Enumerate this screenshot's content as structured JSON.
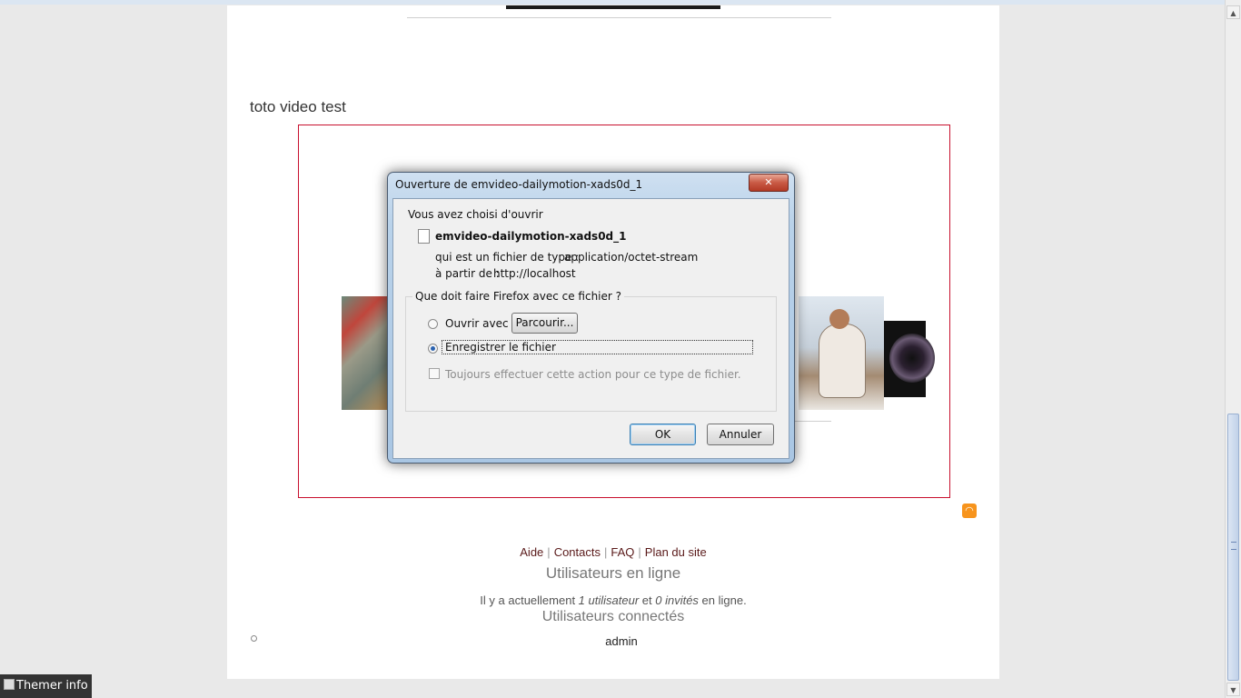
{
  "page": {
    "node_title": "toto video test",
    "rss_icon": "rss-icon"
  },
  "footer": {
    "links": [
      "Aide",
      "Contacts",
      "FAQ",
      "Plan du site"
    ],
    "online_title": "Utilisateurs en ligne",
    "online_text_pre": "Il y a actuellement ",
    "online_users": "1 utilisateur",
    "online_text_mid": " et ",
    "online_guests": "0 invités",
    "online_text_post": " en ligne.",
    "connected_title": "Utilisateurs connectés",
    "user": "admin"
  },
  "themer": {
    "label": "Themer info"
  },
  "dialog": {
    "title": "Ouverture de emvideo-dailymotion-xads0d_1",
    "chosen_label": "Vous avez choisi d'ouvrir",
    "file_name": "emvideo-dailymotion-xads0d_1",
    "type_label": "qui est un fichier de type :",
    "type_value": "application/octet-stream",
    "from_label": "à partir de :",
    "from_value": "http://localhost",
    "question": "Que doit faire Firefox avec ce fichier ?",
    "open_with_label": "Ouvrir avec",
    "browse_label": "Parcourir...",
    "save_label": "Enregistrer le fichier",
    "always_label": "Toujours effectuer cette action pour ce type de fichier.",
    "ok_label": "OK",
    "cancel_label": "Annuler",
    "selected_option": "save",
    "accent": "#2a62b0"
  }
}
